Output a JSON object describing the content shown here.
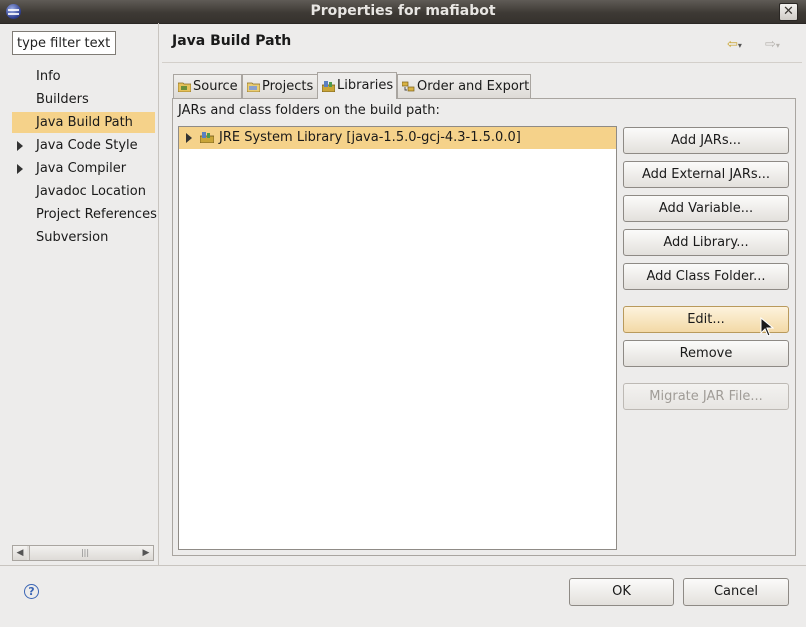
{
  "window": {
    "title": "Properties for mafiabot"
  },
  "sidebar": {
    "filter_placeholder": "type filter text",
    "items": [
      {
        "label": "Info",
        "expandable": false,
        "selected": false
      },
      {
        "label": "Builders",
        "expandable": false,
        "selected": false
      },
      {
        "label": "Java Build Path",
        "expandable": false,
        "selected": true
      },
      {
        "label": "Java Code Style",
        "expandable": true,
        "selected": false
      },
      {
        "label": "Java Compiler",
        "expandable": true,
        "selected": false
      },
      {
        "label": "Javadoc Location",
        "expandable": false,
        "selected": false
      },
      {
        "label": "Project References",
        "expandable": false,
        "selected": false
      },
      {
        "label": "Subversion",
        "expandable": false,
        "selected": false
      }
    ]
  },
  "main": {
    "title": "Java Build Path",
    "tabs": [
      {
        "label": "Source",
        "icon": "source-folder-icon",
        "active": false
      },
      {
        "label": "Projects",
        "icon": "projects-icon",
        "active": false
      },
      {
        "label": "Libraries",
        "icon": "libraries-icon",
        "active": true
      },
      {
        "label": "Order and Export",
        "icon": "order-export-icon",
        "active": false
      }
    ],
    "list_label": "JARs and class folders on the build path:",
    "libraries": [
      {
        "label": "JRE System Library [java-1.5.0-gcj-4.3-1.5.0.0]",
        "icon": "library-jar-icon",
        "selected": true
      }
    ],
    "buttons": {
      "add_jars": "Add JARs...",
      "add_external_jars": "Add External JARs...",
      "add_variable": "Add Variable...",
      "add_library": "Add Library...",
      "add_class_folder": "Add Class Folder...",
      "edit": "Edit...",
      "remove": "Remove",
      "migrate_jar": "Migrate JAR File..."
    }
  },
  "footer": {
    "ok": "OK",
    "cancel": "Cancel"
  },
  "colors": {
    "selection": "#f5d28a",
    "titlebar": "#3e3a35",
    "help": "#3b66b5"
  }
}
